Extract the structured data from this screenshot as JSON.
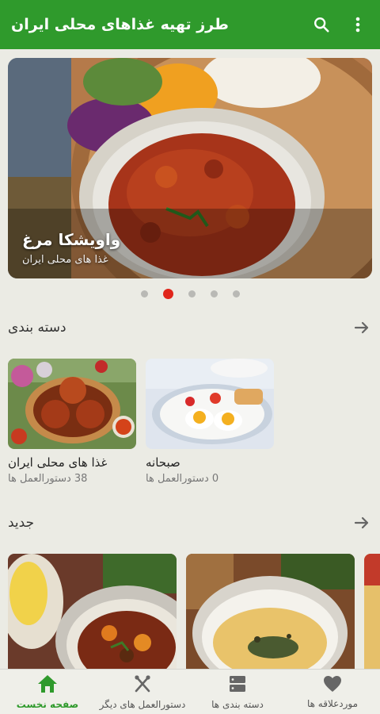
{
  "appbar": {
    "title": "طرز تهیه غذاهای محلی ایران"
  },
  "banner": {
    "title": "واویشکا مرغ",
    "subtitle": "غذا های محلی ایران",
    "active_index": 1,
    "count": 5
  },
  "categories": {
    "title": "دسته بندی",
    "items": [
      {
        "name": "غذا های محلی ایران",
        "count": "38 دستورالعمل ها"
      },
      {
        "name": "صبحانه",
        "count": "0 دستورالعمل ها"
      }
    ]
  },
  "new_section": {
    "title": "جدید"
  },
  "nav": {
    "items": [
      {
        "label": "صفحه نخست",
        "icon": "home-icon",
        "active": true
      },
      {
        "label": "دستورالعمل های دیگر",
        "icon": "fork-knife-icon"
      },
      {
        "label": "دسته بندی ها",
        "icon": "category-icon"
      },
      {
        "label": "موردعلاقه ها",
        "icon": "heart-icon"
      }
    ]
  },
  "colors": {
    "primary": "#2f9a2c",
    "dot_active": "#e0261b",
    "background": "#ebebe4"
  }
}
